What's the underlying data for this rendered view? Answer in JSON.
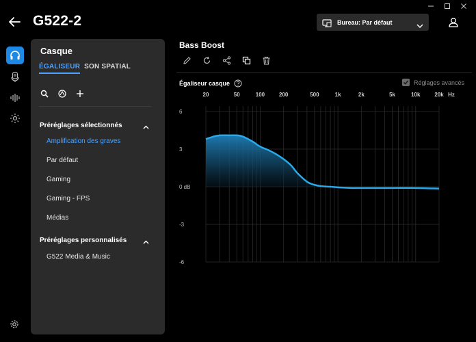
{
  "window": {
    "controls": [
      "minimize-icon",
      "maximize-icon",
      "close-icon"
    ]
  },
  "header": {
    "device_title": "G522-2",
    "profile_label": "Bureau: Par défaut"
  },
  "rail": {
    "items": [
      {
        "icon": "headset-icon",
        "active": true
      },
      {
        "icon": "microphone-icon",
        "active": false
      },
      {
        "icon": "audio-waves-icon",
        "active": false
      },
      {
        "icon": "lighting-icon",
        "active": false
      }
    ]
  },
  "panel": {
    "title": "Casque",
    "tabs": [
      {
        "label": "ÉGALISEUR",
        "active": true
      },
      {
        "label": "SON SPATIAL",
        "active": false
      }
    ],
    "selected_presets_header": "Préréglages sélectionnés",
    "selected_presets": [
      {
        "label": "Amplification des graves",
        "selected": true
      },
      {
        "label": "Par défaut",
        "selected": false
      },
      {
        "label": "Gaming",
        "selected": false
      },
      {
        "label": "Gaming - FPS",
        "selected": false
      },
      {
        "label": "Médias",
        "selected": false
      }
    ],
    "custom_presets_header": "Préréglages personnalisés",
    "custom_presets": [
      {
        "label": "G522 Media & Music"
      }
    ]
  },
  "editor": {
    "preset_name": "Bass Boost",
    "eq_label": "Égaliseur casque",
    "advanced_label": "Réglages avancés",
    "advanced_checked": true
  },
  "chart_data": {
    "type": "area",
    "x_scale": "log",
    "x_ticks": [
      "20",
      "50",
      "100",
      "200",
      "500",
      "1k",
      "2k",
      "5k",
      "10k",
      "20k"
    ],
    "x_tick_values": [
      20,
      50,
      100,
      200,
      500,
      1000,
      2000,
      5000,
      10000,
      20000
    ],
    "x_unit": "Hz",
    "y_ticks": [
      "6",
      "3",
      "0 dB",
      "-3",
      "-6"
    ],
    "y_tick_values": [
      6,
      3,
      0,
      -3,
      -6
    ],
    "ylim": [
      -6,
      6
    ],
    "xlim": [
      20,
      20000
    ],
    "x": [
      20,
      25,
      30,
      40,
      50,
      60,
      80,
      100,
      130,
      160,
      200,
      250,
      300,
      400,
      500,
      600,
      800,
      1000,
      1500,
      2000,
      3000,
      5000,
      10000,
      20000
    ],
    "y": [
      3.8,
      4.0,
      4.1,
      4.1,
      4.1,
      4.0,
      3.6,
      3.2,
      2.9,
      2.6,
      2.2,
      1.7,
      1.1,
      0.4,
      0.15,
      0.05,
      0.0,
      -0.05,
      -0.1,
      -0.1,
      -0.1,
      -0.1,
      -0.1,
      -0.15
    ],
    "line_color": "#2aa8e8",
    "grid": true
  }
}
